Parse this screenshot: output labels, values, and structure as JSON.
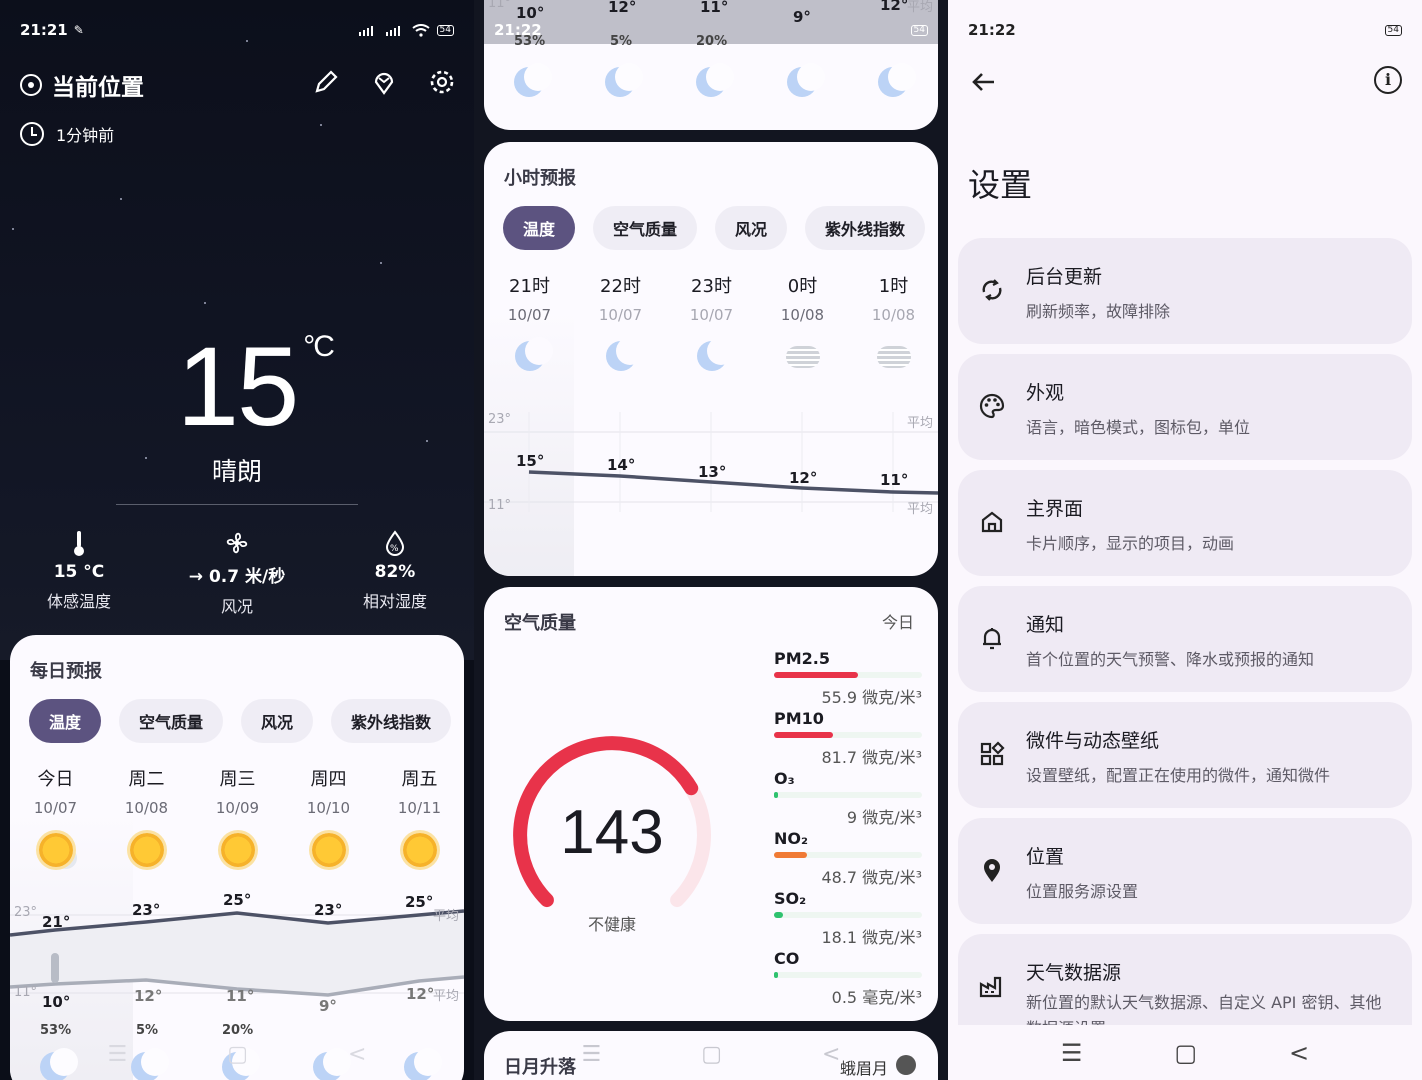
{
  "panel1": {
    "status": {
      "time": "21:21",
      "battery": "54"
    },
    "location": "当前位置",
    "updated": "1分钟前",
    "temperature": "15",
    "unit": "°C",
    "condition": "晴朗",
    "stats": [
      {
        "value": "15 °C",
        "label": "体感温度"
      },
      {
        "value": "→ 0.7 米/秒",
        "label": "风况"
      },
      {
        "value": "82%",
        "label": "相对湿度"
      }
    ],
    "daily": {
      "title": "每日预报",
      "tabs": [
        "温度",
        "空气质量",
        "风况",
        "紫外线指数"
      ],
      "days": [
        {
          "day": "今日",
          "date": "10/07",
          "high": "21°",
          "low": "10°",
          "precip": "53%"
        },
        {
          "day": "周二",
          "date": "10/08",
          "high": "23°",
          "low": "12°",
          "precip": "5%"
        },
        {
          "day": "周三",
          "date": "10/09",
          "high": "25°",
          "low": "11°",
          "precip": "20%"
        },
        {
          "day": "周四",
          "date": "10/10",
          "high": "23°",
          "low": "9°",
          "precip": ""
        },
        {
          "day": "周五",
          "date": "10/11",
          "high": "25°",
          "low": "12°",
          "precip": ""
        }
      ],
      "axis_high": "23°",
      "axis_low": "11°",
      "avg_label": "平均"
    }
  },
  "panel2": {
    "status": {
      "time": "21:22",
      "battery": "54"
    },
    "top_strip": {
      "lows": [
        "10°",
        "12°",
        "11°",
        "9°",
        "12°"
      ],
      "precip": [
        "53%",
        "5%",
        "20%"
      ],
      "avg_label": "平均",
      "axis_low": "11°"
    },
    "hourly": {
      "title": "小时预报",
      "tabs": [
        "温度",
        "空气质量",
        "风况",
        "紫外线指数"
      ],
      "hours": [
        {
          "hour": "21时",
          "date": "10/07",
          "temp": "15°"
        },
        {
          "hour": "22时",
          "date": "10/07",
          "temp": "14°"
        },
        {
          "hour": "23时",
          "date": "10/07",
          "temp": "13°"
        },
        {
          "hour": "0时",
          "date": "10/08",
          "temp": "12°"
        },
        {
          "hour": "1时",
          "date": "10/08",
          "temp": "11°"
        }
      ],
      "axis_high": "23°",
      "axis_low": "11°",
      "avg_label": "平均"
    },
    "air": {
      "title": "空气质量",
      "period": "今日",
      "aqi": "143",
      "aqi_fraction": 0.72,
      "level": "不健康",
      "accent": "#e8334a",
      "pollutants": [
        {
          "name": "PM2.5",
          "value": "55.9 微克/米³",
          "fraction": 0.57,
          "color": "#e8334a"
        },
        {
          "name": "PM10",
          "value": "81.7 微克/米³",
          "fraction": 0.4,
          "color": "#e8334a"
        },
        {
          "name": "O₃",
          "value": "9 微克/米³",
          "fraction": 0.03,
          "color": "#2fc26f"
        },
        {
          "name": "NO₂",
          "value": "48.7 微克/米³",
          "fraction": 0.22,
          "color": "#f07a35"
        },
        {
          "name": "SO₂",
          "value": "18.1 微克/米³",
          "fraction": 0.06,
          "color": "#2fc26f"
        },
        {
          "name": "CO",
          "value": "0.5 毫克/米³",
          "fraction": 0.02,
          "color": "#2fc26f"
        }
      ]
    },
    "sun_moon": {
      "title": "日月升落",
      "moon_phase": "蛾眉月"
    }
  },
  "panel3": {
    "status": {
      "time": "21:22",
      "battery": "54"
    },
    "title": "设置",
    "items": [
      {
        "title": "后台更新",
        "subtitle": "刷新频率，故障排除",
        "icon": "sync-icon"
      },
      {
        "title": "外观",
        "subtitle": "语言，暗色模式，图标包，单位",
        "icon": "palette-icon"
      },
      {
        "title": "主界面",
        "subtitle": "卡片顺序，显示的项目，动画",
        "icon": "home-icon"
      },
      {
        "title": "通知",
        "subtitle": "首个位置的天气预警、降水或预报的通知",
        "icon": "bell-icon"
      },
      {
        "title": "微件与动态壁纸",
        "subtitle": "设置壁纸，配置正在使用的微件，通知微件",
        "icon": "widgets-icon"
      },
      {
        "title": "位置",
        "subtitle": "位置服务源设置",
        "icon": "location-pin-icon"
      },
      {
        "title": "天气数据源",
        "subtitle": "新位置的默认天气数据源、自定义 API 密钥、其他数据源设置",
        "icon": "factory-icon"
      }
    ]
  }
}
